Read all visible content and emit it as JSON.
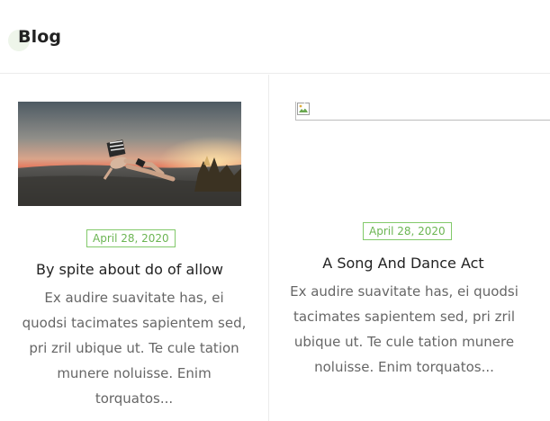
{
  "header": {
    "title": "Blog"
  },
  "posts": [
    {
      "image": {
        "kind": "photo",
        "icon": "photo-thumbnail"
      },
      "date": "April 28, 2020",
      "title": "By spite about do of allow",
      "excerpt": "Ex audire suavitate has, ei quodsi tacimates sapientem sed, pri zril ubique ut. Te cule tation munere noluisse. Enim torquatos..."
    },
    {
      "image": {
        "kind": "broken",
        "icon": "broken-image-icon"
      },
      "date": "April 28, 2020",
      "title": "A Song And Dance Act",
      "excerpt": "Ex audire suavitate has, ei quodsi tacimates sapientem sed, pri zril ubique ut. Te cule tation munere noluisse. Enim torquatos..."
    }
  ],
  "colors": {
    "accent": "#6cb553",
    "divider": "#ececec",
    "text": "#222222",
    "muted": "#666666"
  }
}
